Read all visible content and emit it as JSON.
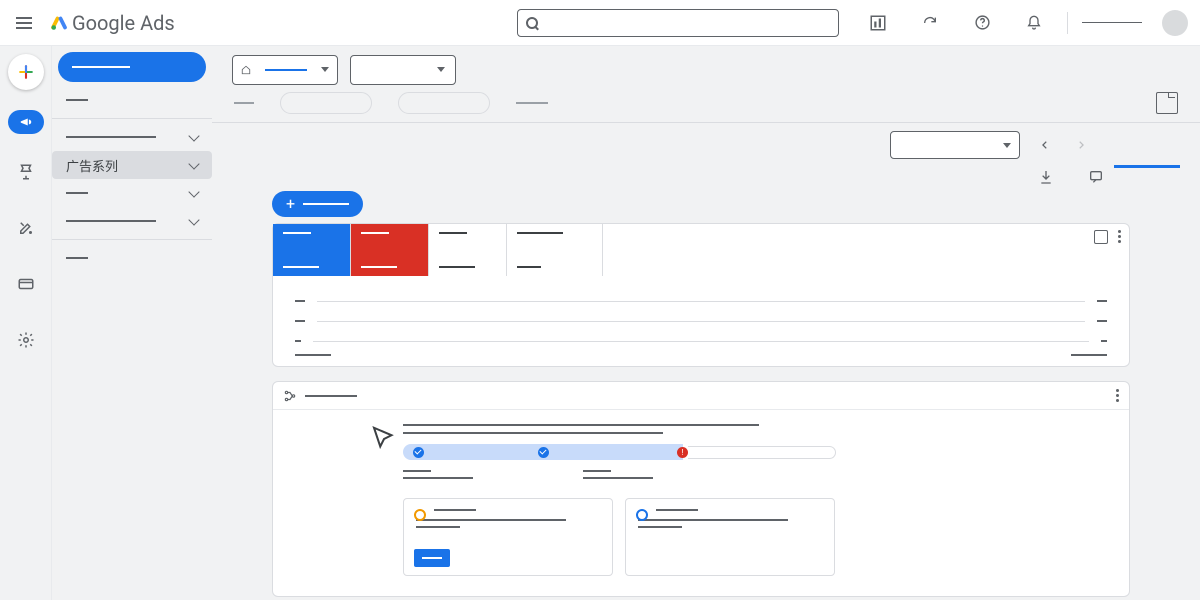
{
  "header": {
    "product_name": "Google Ads",
    "search_placeholder": ""
  },
  "header_icons": [
    "reports-icon",
    "refresh-icon",
    "help-icon",
    "notifications-icon"
  ],
  "left_rail": [
    {
      "name": "create-button",
      "variant": "plus"
    },
    {
      "name": "campaigns-rail",
      "variant": "active"
    },
    {
      "name": "goals-rail",
      "variant": "plain"
    },
    {
      "name": "tools-rail",
      "variant": "plain"
    },
    {
      "name": "billing-rail",
      "variant": "plain"
    },
    {
      "name": "admin-rail",
      "variant": "plain"
    }
  ],
  "sidebar": {
    "primary_label": "",
    "items": [
      {
        "label": "",
        "expandable": false,
        "type": "small"
      },
      {
        "label": "",
        "expandable": true,
        "type": "sub"
      },
      {
        "label": "广告系列",
        "expandable": true,
        "active": true,
        "type": "text"
      },
      {
        "label": "",
        "expandable": true,
        "type": "small"
      },
      {
        "label": "",
        "expandable": true,
        "type": "sub"
      },
      {
        "label": "",
        "expandable": false,
        "type": "small"
      }
    ]
  },
  "account_selector": {
    "value": ""
  },
  "date_selector": {
    "value": ""
  },
  "create_button_label": "",
  "scorecards": [
    {
      "variant": "blue"
    },
    {
      "variant": "red"
    },
    {
      "variant": "plain"
    },
    {
      "variant": "plain wide"
    }
  ],
  "progress": {
    "steps": [
      {
        "state": "done"
      },
      {
        "state": "done"
      },
      {
        "state": "error"
      }
    ]
  },
  "cards": [
    {
      "icon": "target-icon",
      "has_button": true
    },
    {
      "icon": "chart-icon",
      "has_button": false
    }
  ]
}
